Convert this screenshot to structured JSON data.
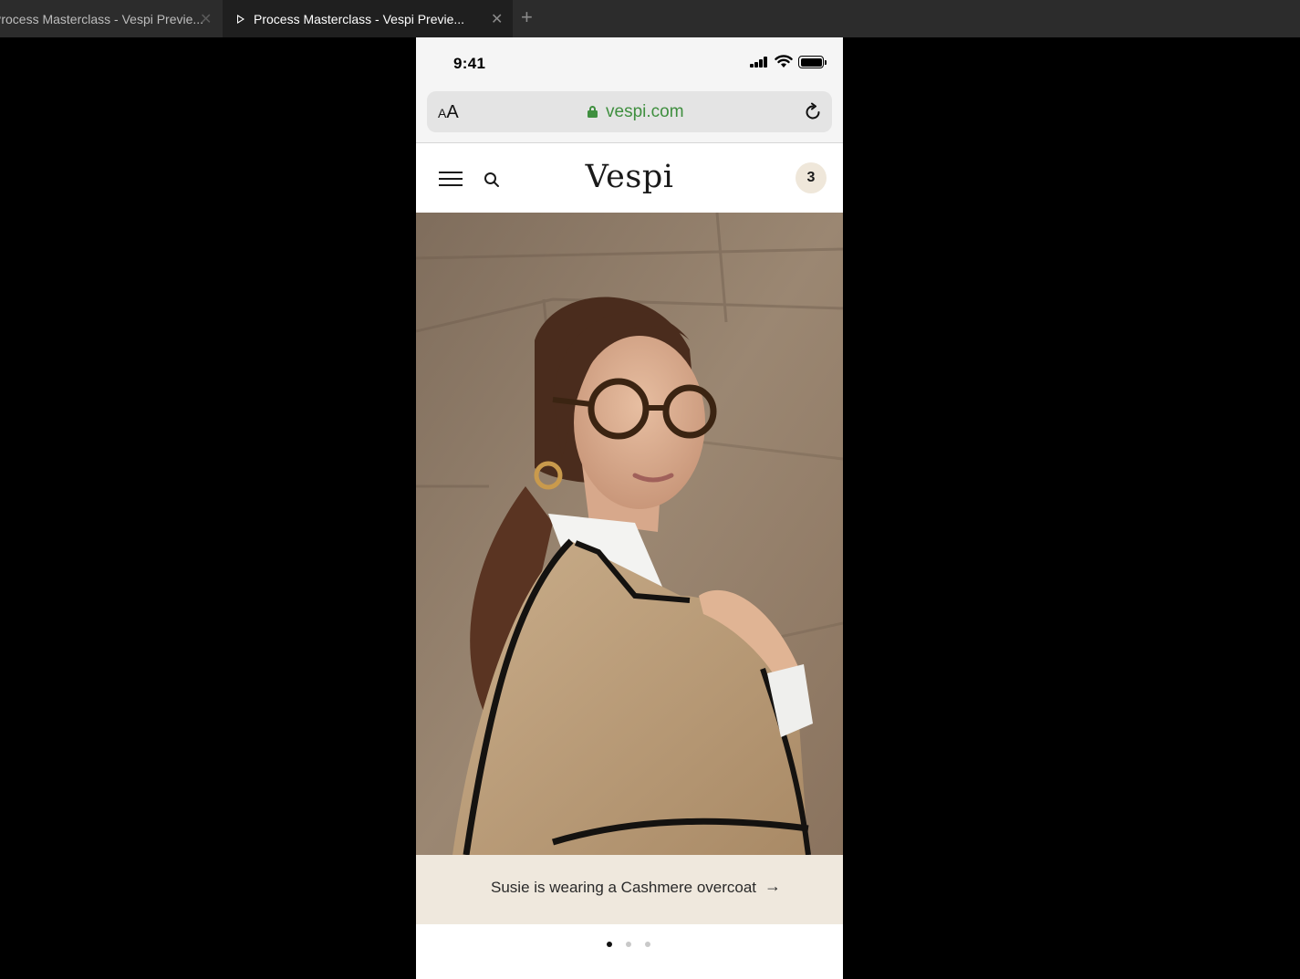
{
  "browser": {
    "tabs": [
      {
        "title": "Process Masterclass - Vespi Previe...",
        "active": false
      },
      {
        "title": "Process Masterclass - Vespi Previe...",
        "active": true
      }
    ],
    "new_tab_icon": "plus-icon"
  },
  "status_bar": {
    "time": "9:41",
    "icons": [
      "signal-icon",
      "wifi-icon",
      "battery-icon"
    ]
  },
  "url_bar": {
    "text_size_label": "AA",
    "url": "vespi.com",
    "secure": true,
    "lock_color": "#3f8f3f"
  },
  "site_nav": {
    "brand": "Vespi",
    "cart_count": "3",
    "cart_badge_color": "#efe7da"
  },
  "hero": {
    "image_icon": "portrait-photo",
    "caption": "Susie is wearing a Cashmere overcoat",
    "caption_arrow": "→",
    "caption_bg": "#efe8dd"
  },
  "carousel": {
    "total": 3,
    "active_index": 0
  }
}
